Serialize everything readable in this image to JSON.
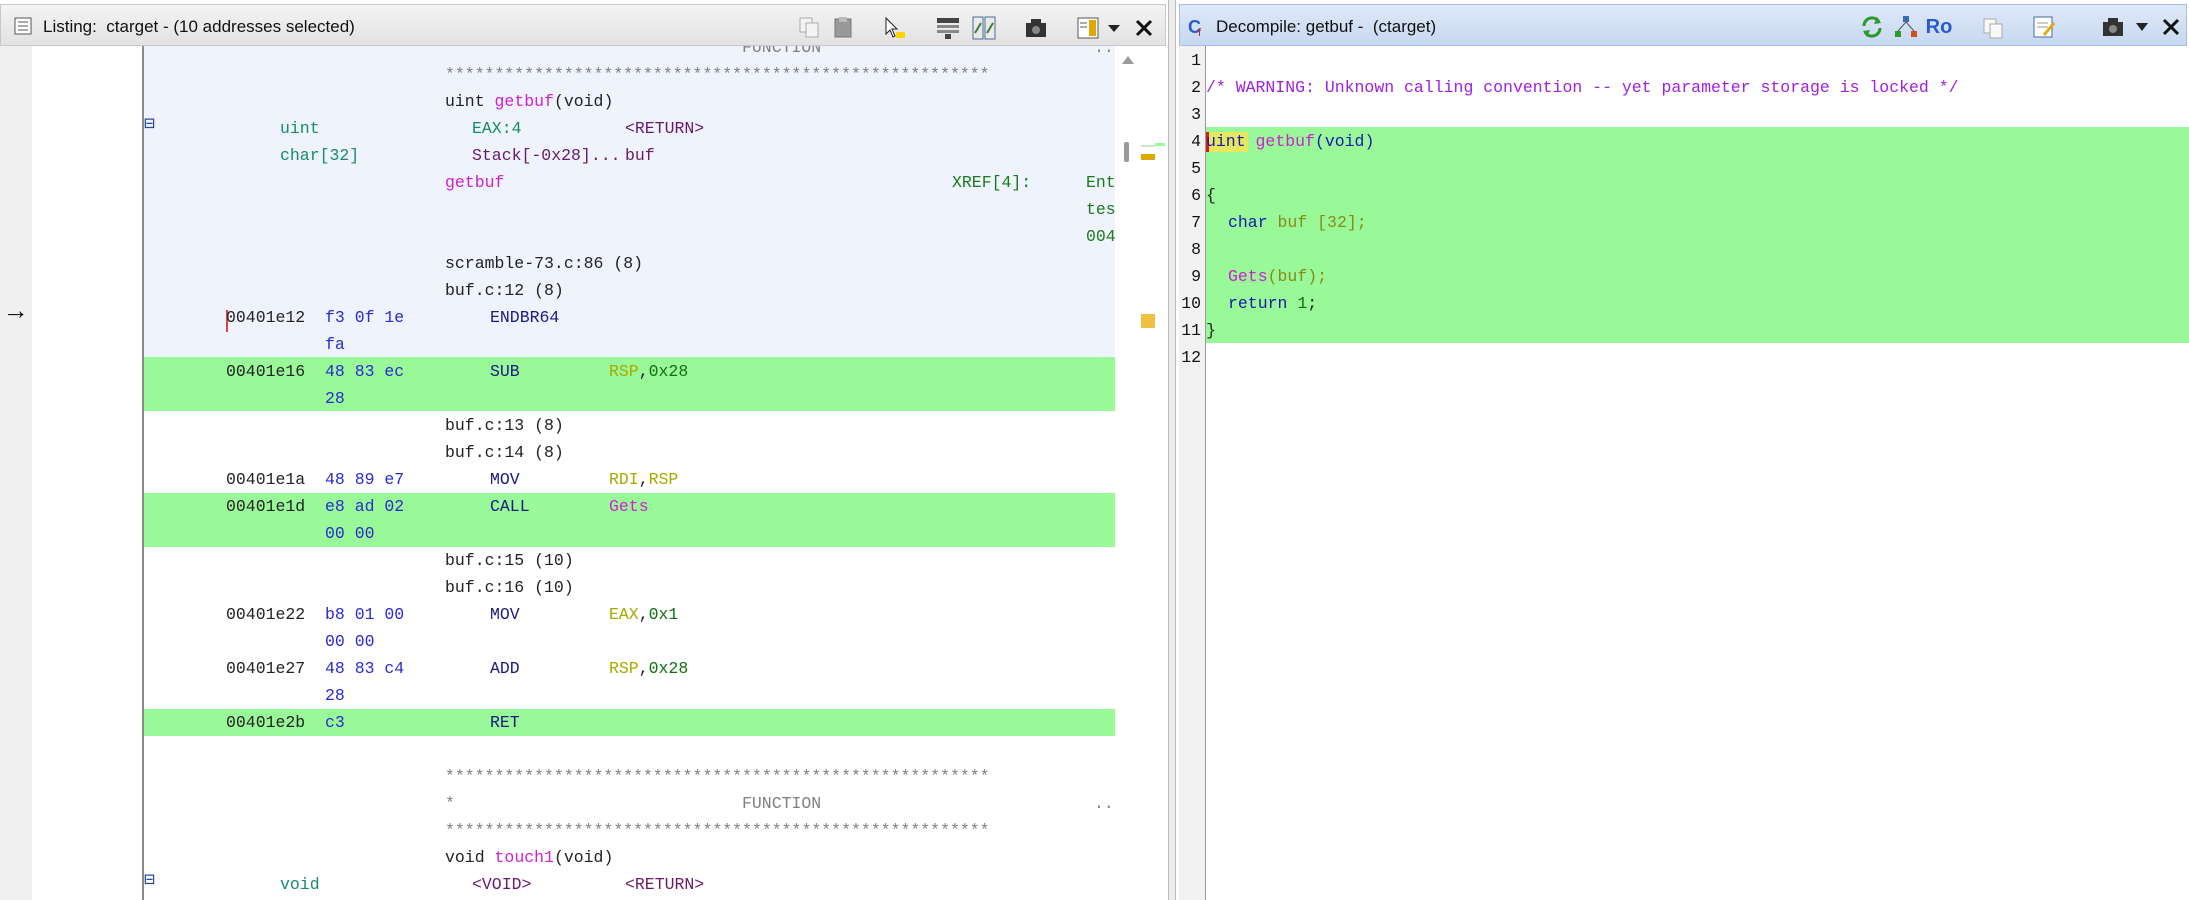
{
  "listing": {
    "title": "Listing:  ctarget - (10 addresses selected)",
    "icons": [
      "listing-icon",
      "copy-icon",
      "paste-icon",
      "cursor-select-icon",
      "field-select-icon",
      "diff-icon",
      "snapshot-icon",
      "display-mode-icon",
      "dropdown-icon",
      "close-icon"
    ],
    "header_lines": {
      "star_line": "*",
      "function_tag": "FUNCTION",
      "ellipsis": "...",
      "stars": "*******************************************************",
      "signature_type": "uint",
      "signature_name": "getbuf",
      "signature_params": "(void)",
      "ret_type": "uint",
      "ret_storage": "EAX:4",
      "ret_name": "<RETURN>",
      "local_type": "char[32]",
      "local_storage": "Stack[-0x28]...",
      "local_name": "buf",
      "label": "getbuf",
      "xref": "XREF[4]:",
      "xref_1": "Ent",
      "xref_2": "tes",
      "xref_3": "004",
      "src_1": "scramble-73.c:86 (8)",
      "src_2": "buf.c:12 (8)"
    },
    "rows": [
      {
        "addr": "00401e12",
        "bytes": "f3 0f 1e",
        "bytes2": "fa",
        "mn": "ENDBR64",
        "op1": "",
        "sep": "",
        "op2": ""
      },
      {
        "addr": "00401e16",
        "bytes": "48 83 ec",
        "bytes2": "28",
        "mn": "SUB",
        "op1": "RSP",
        "sep": ",",
        "op2": "0x28"
      },
      {
        "addr": "00401e1a",
        "bytes": "48 89 e7",
        "bytes2": "",
        "mn": "MOV",
        "op1": "RDI",
        "sep": ",",
        "op2": "RSP"
      },
      {
        "addr": "00401e1d",
        "bytes": "e8 ad 02",
        "bytes2": "00 00",
        "mn": "CALL",
        "op1": "",
        "sep": "",
        "op2": "Gets"
      },
      {
        "addr": "00401e22",
        "bytes": "b8 01 00",
        "bytes2": "00 00",
        "mn": "MOV",
        "op1": "EAX",
        "sep": ",",
        "op2": "0x1"
      },
      {
        "addr": "00401e27",
        "bytes": "48 83 c4",
        "bytes2": "28",
        "mn": "ADD",
        "op1": "RSP",
        "sep": ",",
        "op2": "0x28"
      },
      {
        "addr": "00401e2b",
        "bytes": "c3",
        "bytes2": "",
        "mn": "RET",
        "op1": "",
        "sep": "",
        "op2": ""
      }
    ],
    "src_lines": {
      "s13": "buf.c:13 (8)",
      "s14": "buf.c:14 (8)",
      "s15": "buf.c:15 (10)",
      "s16": "buf.c:16 (10)"
    },
    "footer": {
      "stars": "*******************************************************",
      "star_line": "*",
      "function_tag": "FUNCTION",
      "ellipsis": "...",
      "signature_type": "void",
      "signature_name": "touch1",
      "signature_params": "(void)",
      "ret_type": "void",
      "ret_storage": "<VOID>",
      "ret_name": "<RETURN>"
    },
    "arrow": "→",
    "collapse": "⊟"
  },
  "decompile": {
    "title": "Decompile: getbuf -  (ctarget)",
    "icons": [
      "decompile-icon",
      "refresh-icon",
      "graph-icon",
      "readonly-icon",
      "copy-icon",
      "edit-icon",
      "snapshot-icon",
      "dropdown-icon",
      "close-icon"
    ],
    "readonly_label": "Ro",
    "line_numbers": [
      "1",
      "2",
      "3",
      "4",
      "5",
      "6",
      "7",
      "8",
      "9",
      "10",
      "11",
      "12"
    ],
    "code": {
      "warning": "/* WARNING: Unknown calling convention -- yet parameter storage is locked */",
      "ret_type": "uint",
      "fn_name": "getbuf",
      "params": "(void)",
      "open_brace": "{",
      "decl_type": "char",
      "decl_var": "buf",
      "decl_size": "[32];",
      "call_fn": "Gets",
      "call_args_open": "(",
      "call_arg": "buf",
      "call_args_close": ");",
      "ret_kw": "return",
      "ret_val": "1",
      "semicolon": ";",
      "close_brace": "}"
    }
  },
  "colors": {
    "selection_green": "#99f999",
    "header_blue": "#eef3fe",
    "function_name": "#d020d0",
    "register": "#a9a900",
    "byte": "#2a2ad0"
  }
}
